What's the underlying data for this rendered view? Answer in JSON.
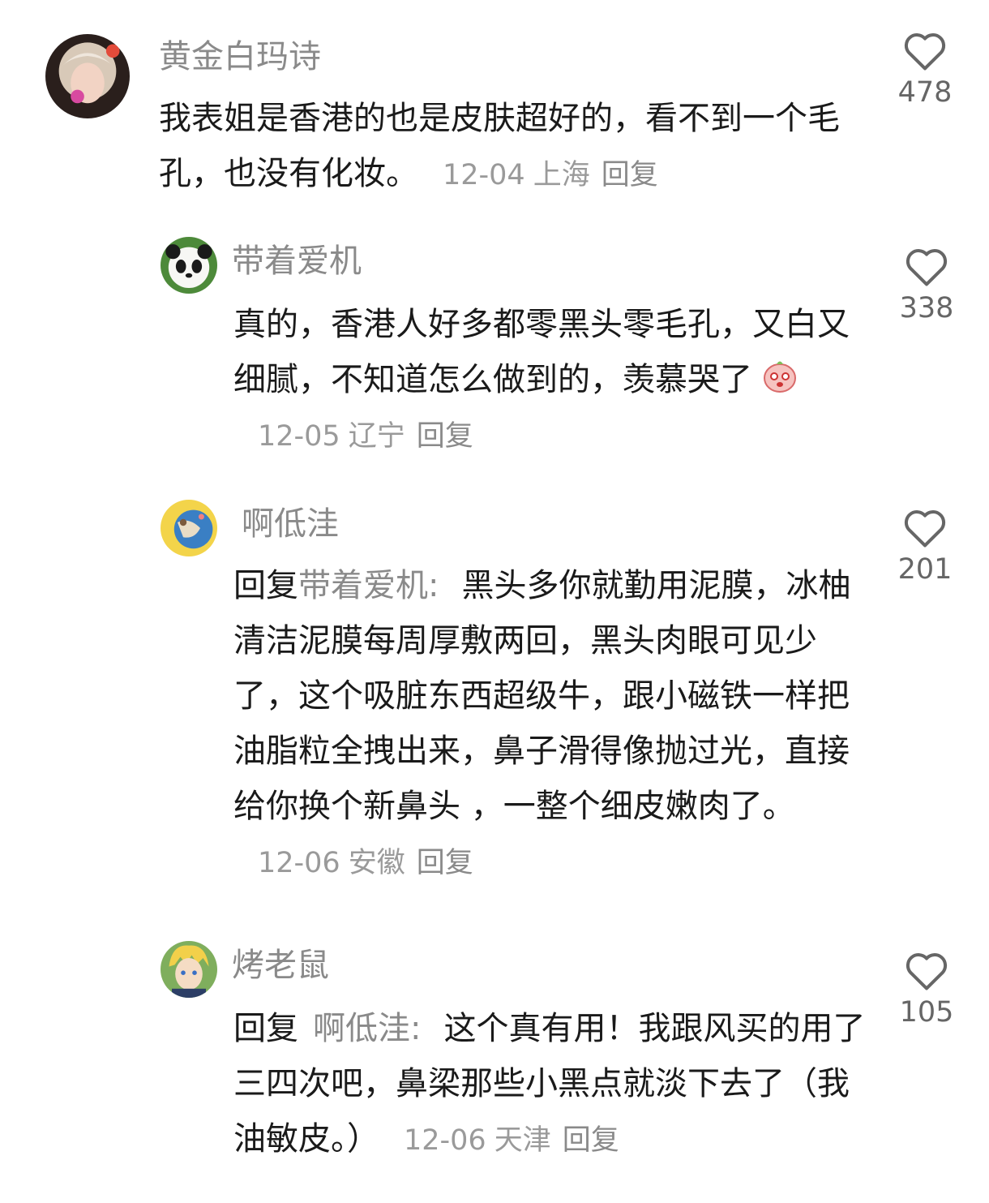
{
  "comments": [
    {
      "username": "黄金白玛诗",
      "text": "我表姐是香港的也是皮肤超好的，看不到一个毛孔，也没有化妆。",
      "date": "12-04",
      "location": "上海",
      "reply_label": "回复",
      "likes": "478"
    },
    {
      "username": "带着爱机",
      "text": "真的，香港人好多都零黑头零毛孔，又白又细腻，不知道怎么做到的，羡慕哭了",
      "emoji": "crying-face-emoji",
      "date": "12-05",
      "location": "辽宁",
      "reply_label": "回复",
      "likes": "338"
    },
    {
      "username": "啊低洼",
      "reply_prefix": "回复",
      "reply_target": "带着爱机:",
      "text": "黑头多你就勤用泥膜，冰柚清洁泥膜每周厚敷两回，黑头肉眼可见少了，这个吸脏东西超级牛，跟小磁铁一样把油脂粒全拽出来，鼻子滑得像抛过光，直接给你换个新鼻头 ，一整个细皮嫩肉了。",
      "date": "12-06",
      "location": "安徽",
      "reply_label": "回复",
      "likes": "201"
    },
    {
      "username": "烤老鼠",
      "reply_prefix": "回复",
      "reply_target": "啊低洼:",
      "text": "这个真有用！我跟风买的用了三四次吧，鼻梁那些小黑点就淡下去了（我油敏皮。）",
      "date": "12-06",
      "location": "天津",
      "reply_label": "回复",
      "likes": "105"
    }
  ],
  "icons": {
    "like": "heart-outline-icon"
  },
  "colors": {
    "username": "#8a8a8a",
    "text": "#1a1a1a",
    "meta": "#9a9a9a"
  }
}
